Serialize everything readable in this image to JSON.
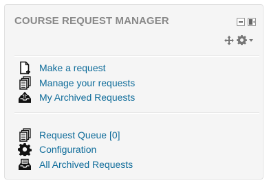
{
  "block": {
    "title": "COURSE REQUEST MANAGER",
    "controls": {
      "minimize_icon": "minus-box-icon",
      "dock_icon": "dock-left-icon",
      "move_icon": "move-arrows-icon",
      "actions_icon": "gear-icon",
      "actions_menu_icon": "caret-down-icon"
    }
  },
  "sections": [
    {
      "items": [
        {
          "label": "Make a request",
          "icon": "new-document-icon"
        },
        {
          "label": "Manage your requests",
          "icon": "documents-stack-icon"
        },
        {
          "label": "My Archived Requests",
          "icon": "archive-upload-icon"
        }
      ]
    },
    {
      "items": [
        {
          "label": "Request Queue [0]",
          "icon": "documents-stack-icon"
        },
        {
          "label": "Configuration",
          "icon": "gear-icon"
        },
        {
          "label": "All Archived Requests",
          "icon": "archive-tray-icon"
        }
      ]
    }
  ],
  "colors": {
    "link": "#0f6c9a",
    "title": "#888888",
    "background": "#f5f5f5"
  }
}
